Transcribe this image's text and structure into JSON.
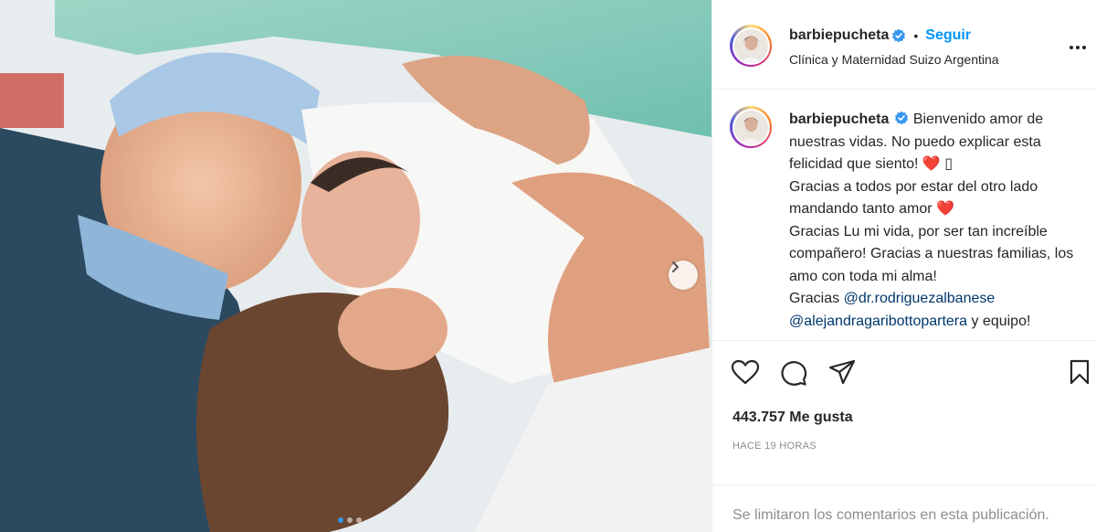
{
  "post": {
    "username": "barbiepucheta",
    "follow_label": "Seguir",
    "separator": "•",
    "location": "Clínica y Maternidad Suizo Argentina",
    "more_icon": "more-options-icon",
    "verified_icon": "verified-badge-icon",
    "media": {
      "description_icon": "photo-carousel",
      "dots": 3,
      "active_dot": 1
    },
    "caption": {
      "line1": "Bienvenido amor de nuestras vidas. No puedo explicar esta felicidad que siento!",
      "line1_emoji": "❤️",
      "line1_emoji2": "▯",
      "line2": "Gracias a todos por estar del otro lado mandando tanto amor",
      "line2_emoji": "❤️",
      "line3": "Gracias Lu mi vida, por ser tan increíble compañero! Gracias a nuestras familias, los amo con toda mi alma!",
      "line4_prefix": "Gracias",
      "mention1": "@dr.rodriguezalbanese",
      "mention2": "@alejandragaribottopartera",
      "line5_suffix": "y equipo!"
    },
    "likes": "443.757 Me gusta",
    "timestamp": "HACE 19 HORAS",
    "comments_limited": "Se limitaron los comentarios en esta publicación."
  },
  "colors": {
    "accent_blue": "#0095f6",
    "heart_red": "#d0022e",
    "muted": "#8e8e8e",
    "text": "#262626"
  }
}
